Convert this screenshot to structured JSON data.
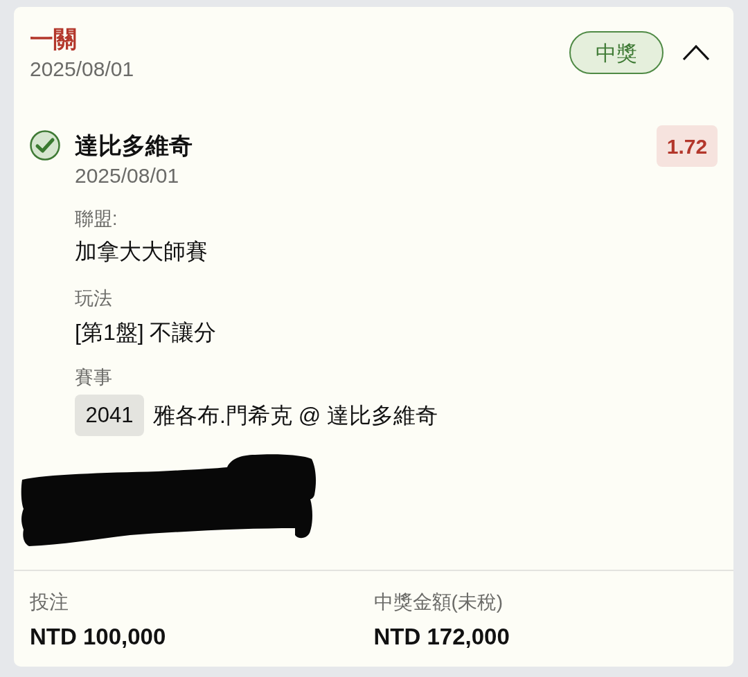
{
  "bet": {
    "type_label": "一關",
    "date": "2025/08/01",
    "status_badge": "中獎",
    "expanded": true
  },
  "selections": [
    {
      "won": true,
      "name": "達比多維奇",
      "date": "2025/08/01",
      "odds": "1.72",
      "details": [
        {
          "kind": "text",
          "label": "聯盟:",
          "value": "加拿大大師賽"
        },
        {
          "kind": "text",
          "label": "玩法",
          "value": "[第1盤] 不讓分"
        },
        {
          "kind": "event",
          "label": "賽事",
          "event_number": "2041",
          "value": "雅各布.門希克 @ 達比多維奇"
        }
      ],
      "bet_id_redacted": true
    }
  ],
  "summary": [
    {
      "label": "投注",
      "value": "NTD 100,000"
    },
    {
      "label": "中獎金額(未稅)",
      "value": "NTD 172,000"
    }
  ]
}
